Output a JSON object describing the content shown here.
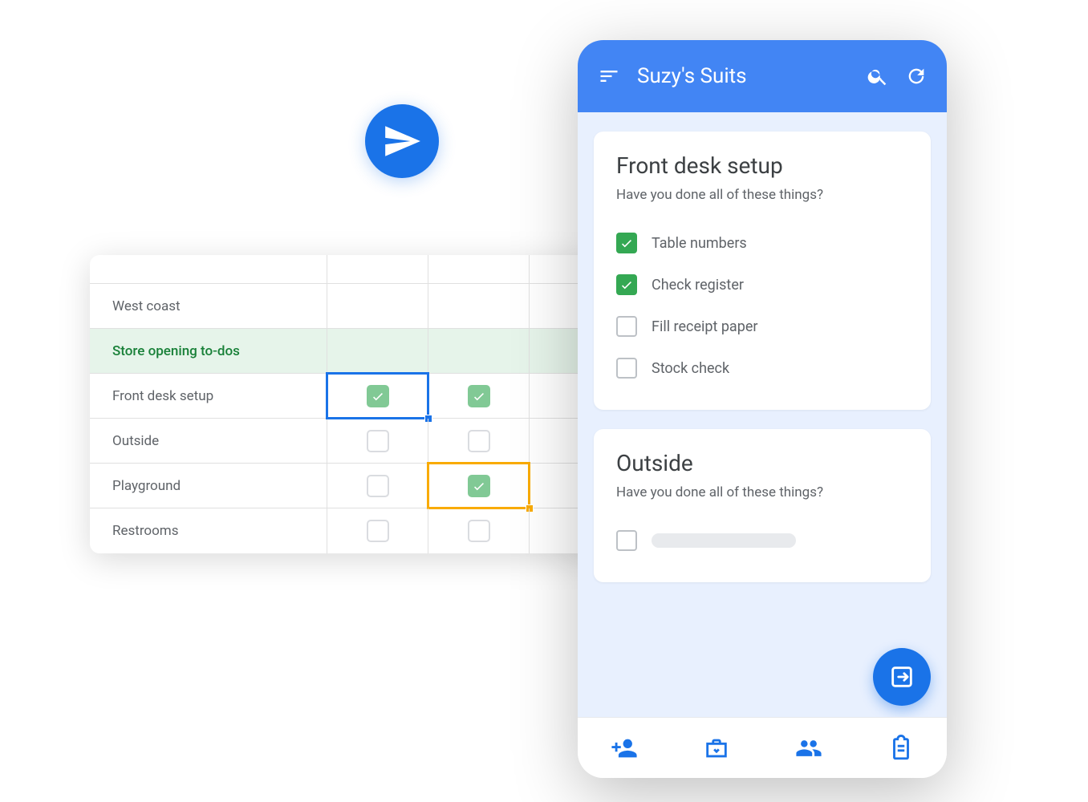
{
  "sheet": {
    "region_label": "West coast",
    "section_label": "Store opening to-dos",
    "rows": [
      {
        "label": "Front desk setup",
        "checks": [
          true,
          true
        ]
      },
      {
        "label": "Outside",
        "checks": [
          false,
          false
        ]
      },
      {
        "label": "Playground",
        "checks": [
          false,
          true
        ]
      },
      {
        "label": "Restrooms",
        "checks": [
          false,
          false
        ]
      }
    ]
  },
  "phone": {
    "header_title": "Suzy's Suits",
    "cards": [
      {
        "title": "Front desk setup",
        "subtitle": "Have you done all of these things?",
        "items": [
          {
            "label": "Table numbers",
            "checked": true
          },
          {
            "label": "Check register",
            "checked": true
          },
          {
            "label": "Fill receipt paper",
            "checked": false
          },
          {
            "label": "Stock check",
            "checked": false
          }
        ]
      },
      {
        "title": "Outside",
        "subtitle": "Have you done all of these things?"
      }
    ]
  },
  "colors": {
    "primary_blue": "#1a73e8",
    "header_blue": "#4285f4",
    "check_green": "#34a853",
    "sheet_green": "#81c995",
    "orange": "#f9ab00"
  }
}
